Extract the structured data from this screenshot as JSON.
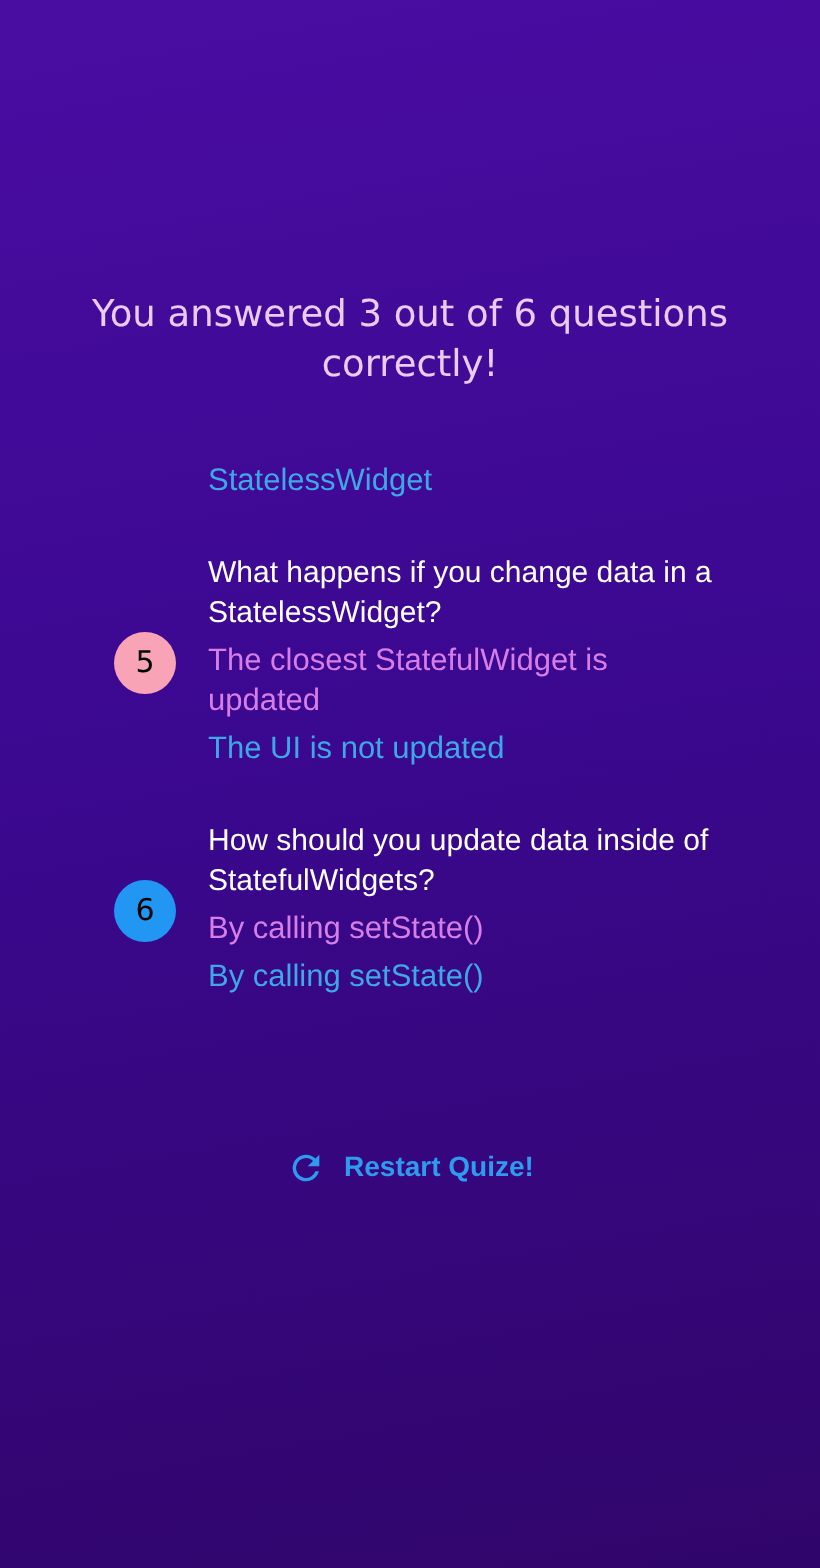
{
  "result_text": "You answered 3 out of 6 questions correctly!",
  "summary": [
    {
      "correct_answer": "StatelessWidget"
    },
    {
      "number": "5",
      "color": "#f9a3b6",
      "question": "What happens if you change data in a StatelessWidget?",
      "user_answer": "The closest StatefulWidget is updated",
      "correct_answer": "The UI is not updated"
    },
    {
      "number": "6",
      "color": "#2196f3",
      "question": "How should you update data inside of StatefulWidgets?",
      "user_answer": "By calling setState()",
      "correct_answer": "By calling setState()"
    }
  ],
  "restart_button": {
    "label": "Restart Quize!"
  }
}
